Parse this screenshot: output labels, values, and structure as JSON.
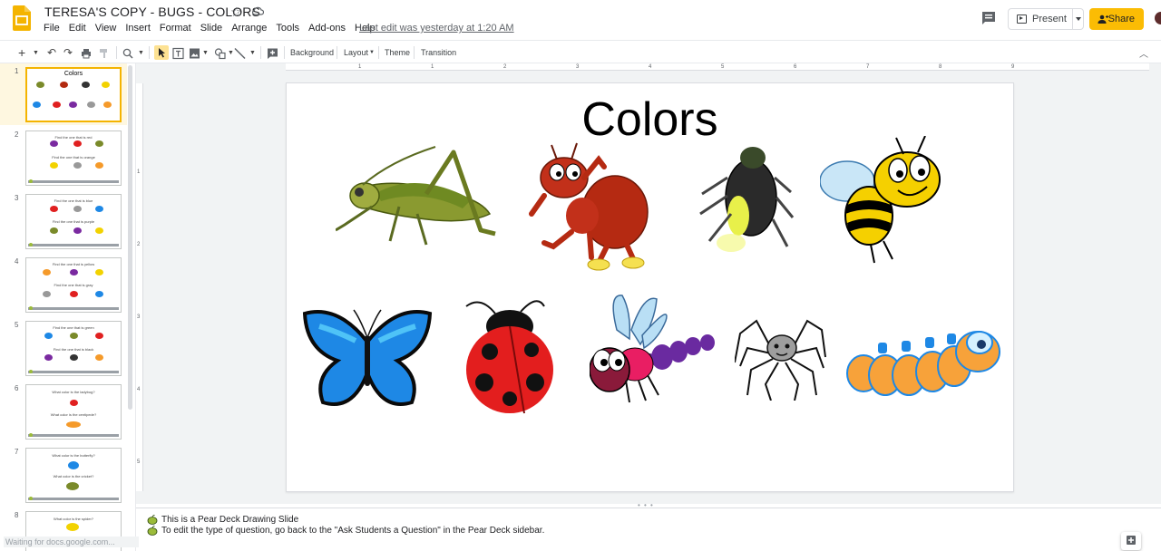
{
  "header": {
    "doc_title": "TERESA'S COPY - BUGS - COLORS",
    "menu": [
      "File",
      "Edit",
      "View",
      "Insert",
      "Format",
      "Slide",
      "Arrange",
      "Tools",
      "Add-ons",
      "Help"
    ],
    "last_edit": "Last edit was yesterday at 1:20 AM",
    "present_label": "Present",
    "share_label": "Share"
  },
  "toolbar": {
    "background_label": "Background",
    "layout_label": "Layout",
    "theme_label": "Theme",
    "transition_label": "Transition"
  },
  "ruler": {
    "top_ticks": [
      "1",
      "1",
      "2",
      "3",
      "4",
      "5",
      "6",
      "7",
      "8",
      "9"
    ],
    "left_ticks": [
      "1",
      "2",
      "3",
      "4",
      "5"
    ]
  },
  "filmstrip": {
    "slides": [
      {
        "num": "1",
        "title": "Colors"
      },
      {
        "num": "2",
        "title": "Find the one that is red",
        "sub": "Find the one that is orange"
      },
      {
        "num": "3",
        "title": "Find the one that is blue",
        "sub": "Find the one that is purple"
      },
      {
        "num": "4",
        "title": "Find the one that is yellow",
        "sub": "Find the one that is gray"
      },
      {
        "num": "5",
        "title": "Find the one that is green",
        "sub": "Find the one that is black"
      },
      {
        "num": "6",
        "title": "What color is the ladybug?",
        "sub": "What color is the centipede?"
      },
      {
        "num": "7",
        "title": "What color is the butterfly?",
        "sub": "What color is the cricket?"
      },
      {
        "num": "8",
        "title": "What color is the spider?"
      }
    ],
    "status": "Waiting for docs.google.com..."
  },
  "slide": {
    "title": "Colors"
  },
  "notes": {
    "line1": "This is a Pear Deck Drawing Slide",
    "line2": "To edit the type of question, go back to the \"Ask Students a Question\" in the Pear Deck sidebar."
  },
  "colors": {
    "accent": "#fbbc04",
    "selected_slide_bg": "#fef7e0",
    "canvas_bg": "#f1f3f4"
  }
}
